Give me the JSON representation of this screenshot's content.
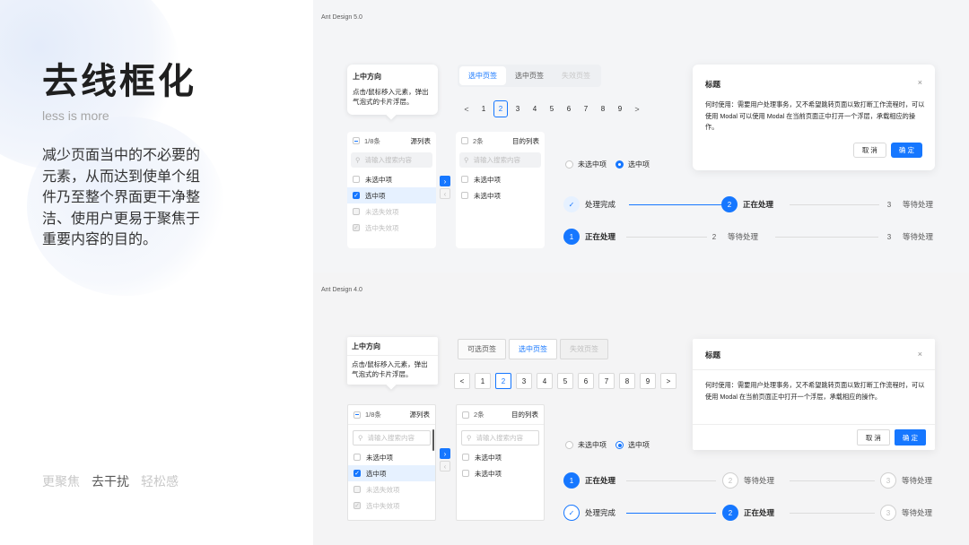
{
  "left": {
    "title": "去线框化",
    "subtitle": "less is more",
    "description": "减少页面当中的不必要的元素，从而达到使单个组件乃至整个界面更干净整洁、使用户更易于聚焦于重要内容的目的。",
    "keywords": [
      "更聚焦",
      "去干扰",
      "轻松感"
    ]
  },
  "v5": {
    "version": "Ant Design 5.0",
    "popover": {
      "title": "上中方向",
      "body": "点击/鼠标移入元素，弹出气泡式的卡片浮层。"
    },
    "tabs": [
      "选中页签",
      "选中页签",
      "失效页签"
    ],
    "pages": [
      "1",
      "2",
      "3",
      "4",
      "5",
      "6",
      "7",
      "8",
      "9"
    ],
    "pager_prev": "<",
    "pager_next": ">",
    "transfer_src": {
      "count": "1/8条",
      "title": "源列表",
      "search": "请输入搜索内容",
      "items": [
        "未选中项",
        "选中项",
        "未选失效项",
        "选中失效项"
      ]
    },
    "transfer_dst": {
      "count": "2条",
      "title": "目的列表",
      "search": "请输入搜索内容",
      "items": [
        "未选中项",
        "未选中项"
      ]
    },
    "radios": [
      "未选中项",
      "选中项"
    ],
    "steps1": [
      {
        "icon": "✓",
        "label": "处理完成"
      },
      {
        "icon": "2",
        "label": "正在处理"
      },
      {
        "icon": "3",
        "label": "等待处理"
      }
    ],
    "steps2": [
      {
        "icon": "1",
        "label": "正在处理"
      },
      {
        "icon": "2",
        "label": "等待处理"
      },
      {
        "icon": "3",
        "label": "等待处理"
      }
    ],
    "modal": {
      "title": "标题",
      "close": "×",
      "body": "何时使用：需要用户处理事务，又不希望跳转页面以致打断工作流程时，可以使用 Modal 可以使用 Modal 在当前页面正中打开一个浮层，承载相应的操作。",
      "cancel": "取 消",
      "ok": "确 定"
    }
  },
  "v4": {
    "version": "Ant Design 4.0",
    "popover": {
      "title": "上中方向",
      "body": "点击/鼠标移入元素，弹出气泡式的卡片浮层。"
    },
    "tabs": [
      "可选页签",
      "选中页签",
      "失效页签"
    ],
    "pages": [
      "1",
      "2",
      "3",
      "4",
      "5",
      "6",
      "7",
      "8",
      "9"
    ],
    "pager_prev": "<",
    "pager_next": ">",
    "transfer_src": {
      "count": "1/8条",
      "title": "源列表",
      "search": "请输入搜索内容",
      "items": [
        "未选中项",
        "选中项",
        "未选失效项",
        "选中失效项"
      ]
    },
    "transfer_dst": {
      "count": "2条",
      "title": "目的列表",
      "search": "请输入搜索内容",
      "items": [
        "未选中项",
        "未选中项"
      ]
    },
    "radios": [
      "未选中项",
      "选中项"
    ],
    "steps1": [
      {
        "icon": "1",
        "label": "正在处理"
      },
      {
        "icon": "2",
        "label": "等待处理"
      },
      {
        "icon": "3",
        "label": "等待处理"
      }
    ],
    "steps2": [
      {
        "icon": "✓",
        "label": "处理完成"
      },
      {
        "icon": "2",
        "label": "正在处理"
      },
      {
        "icon": "3",
        "label": "等待处理"
      }
    ],
    "modal": {
      "title": "标题",
      "close": "×",
      "body": "何时使用：需要用户处理事务，又不希望跳转页面以致打断工作流程时，可以使用 Modal 在当前页面正中打开一个浮层，承载相应的操作。",
      "cancel": "取 消",
      "ok": "确 定"
    }
  },
  "colors": {
    "primary": "#1677ff",
    "text": "#262626"
  }
}
